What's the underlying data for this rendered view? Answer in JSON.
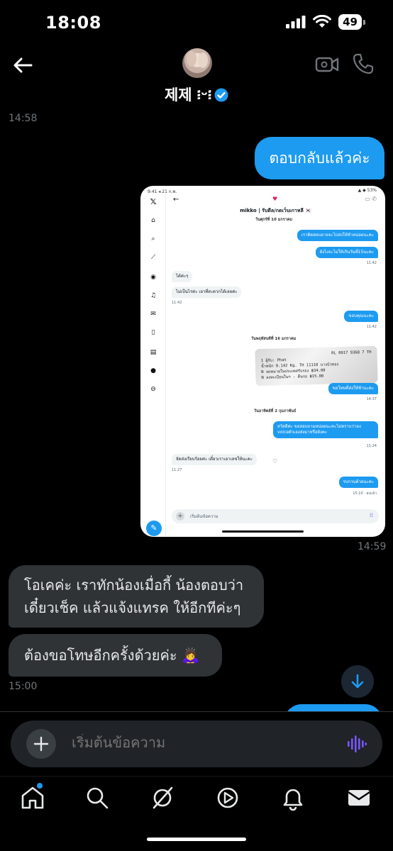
{
  "status_bar": {
    "time": "18:08",
    "battery": "49"
  },
  "header": {
    "contact_name": "제제 ፧ᵕ፧"
  },
  "conversation": {
    "timestamp_1": "14:58",
    "msg_out_1": "ตอบกลับแล้วค่ะ",
    "timestamp_2": "14:59",
    "msg_in_1_line1": "โอเคค่ะ เราทักน้องเมื่อกี้ น้องตอบว่า",
    "msg_in_1_line2": "เดี๋ยวเช็ค แล้วแจ้งแทรค ให้อีกทีค่ะๆ",
    "msg_in_2": "ต้องขอโทษอีกครั้งด้วยค่ะ 🙇‍♀️",
    "timestamp_3": "15:00"
  },
  "screenshot": {
    "status_left": "9:41 ◂ 21 ก.พ.",
    "status_right": "▲ ◆ 53%",
    "title": "mikko | รับดีล/กดเว็บเกาหลี 🇰🇷",
    "date_1": "วันศุกร์ที่ 10 มกราคม",
    "out_1": "เราติดสอบอาจจะไปส่งให้ช้าหน่อยนะคะ",
    "out_2": "ยังไงจะไม่ให้เกินวันที่15นะคะ",
    "ts_1": "11:42",
    "in_1": "ได้ค่ะๆ",
    "in_2": "ไม่เป็นไรค่ะ เอาที่สะดวกได้เลยค่ะ",
    "ts_2": "11:42",
    "out_3": "ขอบคุณนะคะ",
    "ts_3": "11:42",
    "date_2": "วันพฤหัสบดีที่ 16 มกราคม",
    "receipt_line1": "RL 0917 9368 7 TH",
    "receipt_line2": "1 ผู้รับ: Phat",
    "receipt_line3": "น้ำหนัก 0.142 Kg.   TH 11110   บางบัวทอง",
    "receipt_line4": "N จดหมายในประเทศรับรอง         ฿34.00",
    "receipt_line5": "N ลงทะเบียนในฯ - คืนรอ         ฿15.00",
    "out_4": "ขอโทษที่ส่งให้ช้านะคะ",
    "ts_4": "14:37",
    "date_3": "วันอาทิตย์ที่ 2 กุมภาพันธ์",
    "out_5_line1": "สวัสดีค่ะ ขอสอบถามหน่อยนะคะไม่ทราบว่าลง",
    "out_5_line2": "voiceตัวเองส่งมาหรือยังคะ",
    "ts_5": "11:24",
    "in_3": "จัดส่งเรียบร้อยค่ะ เดี๋ยวเราเอาเลขให้นะคะ",
    "ts_6": "11:27",
    "out_6": "รบกวนด้วยนะคะ",
    "ts_7": "15:10 · ส่งแล้ว",
    "input_placeholder": "เริ่มต้นข้อความ"
  },
  "composer": {
    "placeholder": "เริ่มต้นข้อความ"
  },
  "colors": {
    "accent": "#1d9bf0",
    "incoming_bubble": "#2f3336",
    "voice": "#7856ff"
  }
}
